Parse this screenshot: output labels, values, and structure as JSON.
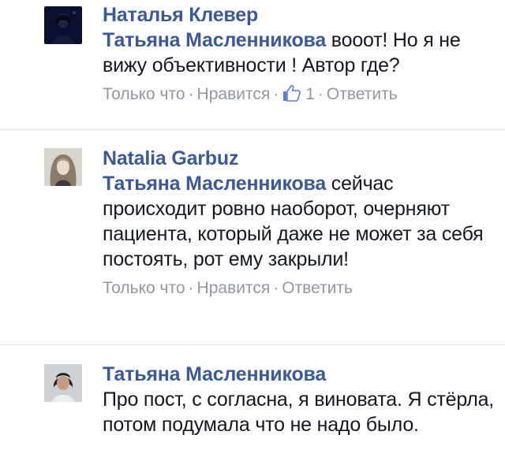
{
  "comments": [
    {
      "author": "Наталья Клевер",
      "mention": "Татьяна Масленникова",
      "text": " вооот! Но я не вижу объективности ! Автор где?",
      "time": "Только что",
      "like_action": "Нравится",
      "like_count": "1",
      "reply_action": "Ответить",
      "avatar_icon": "dark-profile-photo"
    },
    {
      "author": "Natalia Garbuz",
      "mention": "Татьяна Масленникова",
      "text": " сейчас происходит ровно наоборот, очерняют пациента, который даже не может за себя постоять, рот ему закрыли!",
      "time": "Только что",
      "like_action": "Нравится",
      "reply_action": "Ответить",
      "avatar_icon": "blonde-woman-profile-photo"
    },
    {
      "author": "Татьяна Масленникова",
      "text": "Про пост, с согласна, я виновата. Я стёрла, потом подумала что не надо было.",
      "avatar_icon": "dark-hair-woman-profile-photo"
    }
  ],
  "colors": {
    "author": "#3b5998",
    "text": "#141823",
    "meta": "#9197a3",
    "divider": "#e5e6e9"
  },
  "icons": {
    "like": "thumbs-up-icon"
  }
}
